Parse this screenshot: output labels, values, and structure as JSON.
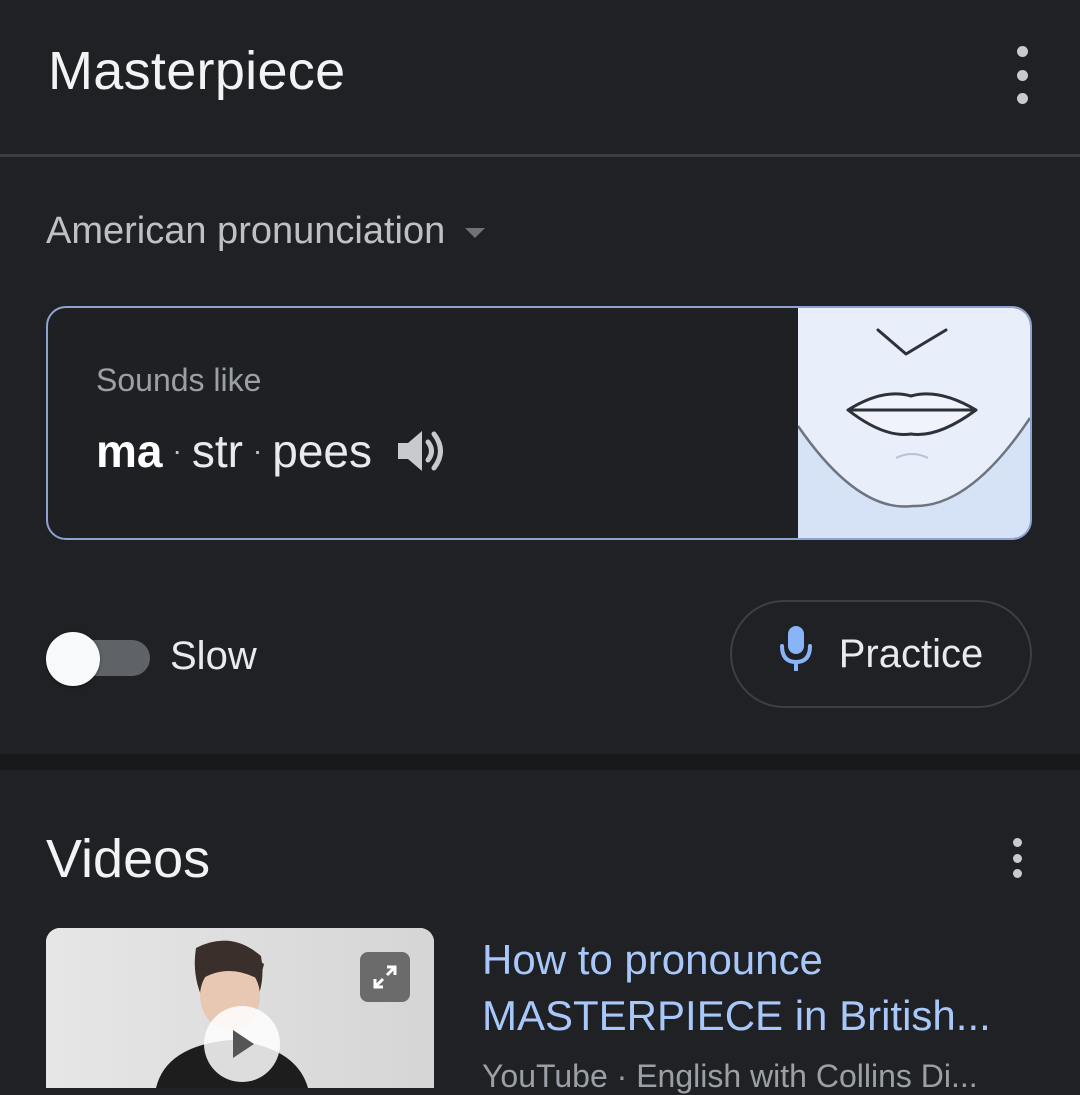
{
  "header": {
    "title": "Masterpiece"
  },
  "pronunciation": {
    "accent_label": "American pronunciation",
    "sounds_like_label": "Sounds like",
    "syllables": [
      "ma",
      "str",
      "pees"
    ],
    "separator": "·"
  },
  "controls": {
    "slow_label": "Slow",
    "slow_enabled": false,
    "practice_label": "Practice"
  },
  "videos": {
    "heading": "Videos",
    "items": [
      {
        "title": "How to pronounce MASTERPIECE in British...",
        "source": "YouTube · English with Collins Di..."
      }
    ]
  },
  "colors": {
    "background": "#202124",
    "link": "#a8c7fa",
    "card_border": "#8ea3cf",
    "mic": "#8ab4f8",
    "mouth_panel": "#e8effb"
  },
  "icons": [
    "more-vert-icon",
    "dropdown-caret-icon",
    "speaker-icon",
    "microphone-icon",
    "expand-icon",
    "play-icon"
  ]
}
